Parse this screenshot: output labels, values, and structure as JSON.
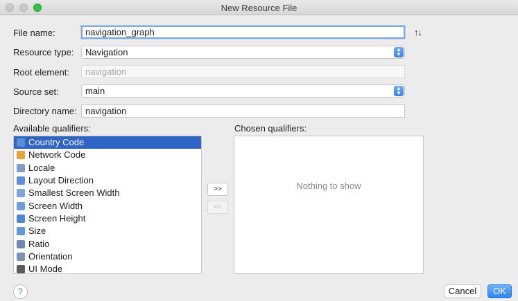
{
  "window": {
    "title": "New Resource File"
  },
  "form": {
    "file_name_label": "File name:",
    "file_name_value": "navigation_graph",
    "resource_type_label": "Resource type:",
    "resource_type_value": "Navigation",
    "root_element_label": "Root element:",
    "root_element_value": "navigation",
    "source_set_label": "Source set:",
    "source_set_value": "main",
    "directory_name_label": "Directory name:",
    "directory_name_value": "navigation",
    "sort_icon_text": "↑↓"
  },
  "qualifiers": {
    "available_label": "Available qualifiers:",
    "chosen_label": "Chosen qualifiers:",
    "available": [
      {
        "label": "Country Code",
        "icon": "country-code-icon",
        "color": "#5a8fd6"
      },
      {
        "label": "Network Code",
        "icon": "network-code-icon",
        "color": "#e8a23a"
      },
      {
        "label": "Locale",
        "icon": "locale-icon",
        "color": "#7f9cc7"
      },
      {
        "label": "Layout Direction",
        "icon": "layout-direction-icon",
        "color": "#5b8fd8"
      },
      {
        "label": "Smallest Screen Width",
        "icon": "smallest-width-icon",
        "color": "#7da7dc"
      },
      {
        "label": "Screen Width",
        "icon": "screen-width-icon",
        "color": "#6f9ed8"
      },
      {
        "label": "Screen Height",
        "icon": "screen-height-icon",
        "color": "#4f87d2"
      },
      {
        "label": "Size",
        "icon": "size-icon",
        "color": "#5f97d9"
      },
      {
        "label": "Ratio",
        "icon": "ratio-icon",
        "color": "#6c88b4"
      },
      {
        "label": "Orientation",
        "icon": "orientation-icon",
        "color": "#7d93b6"
      },
      {
        "label": "UI Mode",
        "icon": "ui-mode-icon",
        "color": "#5a5a5a"
      }
    ],
    "selected_index": 0,
    "empty_text": "Nothing to show",
    "add_button": ">>",
    "remove_button": "<<"
  },
  "footer": {
    "help_text": "?",
    "cancel_label": "Cancel",
    "ok_label": "OK"
  }
}
